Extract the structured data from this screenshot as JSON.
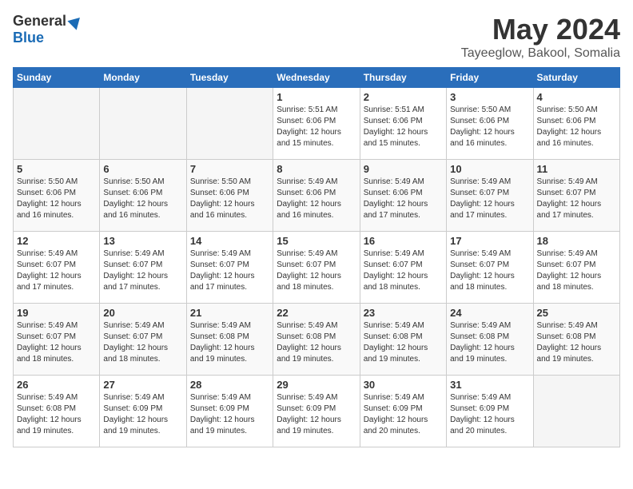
{
  "header": {
    "logo_general": "General",
    "logo_blue": "Blue",
    "title": "May 2024",
    "location": "Tayeeglow, Bakool, Somalia"
  },
  "days_of_week": [
    "Sunday",
    "Monday",
    "Tuesday",
    "Wednesday",
    "Thursday",
    "Friday",
    "Saturday"
  ],
  "weeks": [
    [
      {
        "day": "",
        "empty": true
      },
      {
        "day": "",
        "empty": true
      },
      {
        "day": "",
        "empty": true
      },
      {
        "day": "1",
        "sunrise": "5:51 AM",
        "sunset": "6:06 PM",
        "daylight": "12 hours and 15 minutes."
      },
      {
        "day": "2",
        "sunrise": "5:51 AM",
        "sunset": "6:06 PM",
        "daylight": "12 hours and 15 minutes."
      },
      {
        "day": "3",
        "sunrise": "5:50 AM",
        "sunset": "6:06 PM",
        "daylight": "12 hours and 16 minutes."
      },
      {
        "day": "4",
        "sunrise": "5:50 AM",
        "sunset": "6:06 PM",
        "daylight": "12 hours and 16 minutes."
      }
    ],
    [
      {
        "day": "5",
        "sunrise": "5:50 AM",
        "sunset": "6:06 PM",
        "daylight": "12 hours and 16 minutes."
      },
      {
        "day": "6",
        "sunrise": "5:50 AM",
        "sunset": "6:06 PM",
        "daylight": "12 hours and 16 minutes."
      },
      {
        "day": "7",
        "sunrise": "5:50 AM",
        "sunset": "6:06 PM",
        "daylight": "12 hours and 16 minutes."
      },
      {
        "day": "8",
        "sunrise": "5:49 AM",
        "sunset": "6:06 PM",
        "daylight": "12 hours and 16 minutes."
      },
      {
        "day": "9",
        "sunrise": "5:49 AM",
        "sunset": "6:06 PM",
        "daylight": "12 hours and 17 minutes."
      },
      {
        "day": "10",
        "sunrise": "5:49 AM",
        "sunset": "6:07 PM",
        "daylight": "12 hours and 17 minutes."
      },
      {
        "day": "11",
        "sunrise": "5:49 AM",
        "sunset": "6:07 PM",
        "daylight": "12 hours and 17 minutes."
      }
    ],
    [
      {
        "day": "12",
        "sunrise": "5:49 AM",
        "sunset": "6:07 PM",
        "daylight": "12 hours and 17 minutes."
      },
      {
        "day": "13",
        "sunrise": "5:49 AM",
        "sunset": "6:07 PM",
        "daylight": "12 hours and 17 minutes."
      },
      {
        "day": "14",
        "sunrise": "5:49 AM",
        "sunset": "6:07 PM",
        "daylight": "12 hours and 17 minutes."
      },
      {
        "day": "15",
        "sunrise": "5:49 AM",
        "sunset": "6:07 PM",
        "daylight": "12 hours and 18 minutes."
      },
      {
        "day": "16",
        "sunrise": "5:49 AM",
        "sunset": "6:07 PM",
        "daylight": "12 hours and 18 minutes."
      },
      {
        "day": "17",
        "sunrise": "5:49 AM",
        "sunset": "6:07 PM",
        "daylight": "12 hours and 18 minutes."
      },
      {
        "day": "18",
        "sunrise": "5:49 AM",
        "sunset": "6:07 PM",
        "daylight": "12 hours and 18 minutes."
      }
    ],
    [
      {
        "day": "19",
        "sunrise": "5:49 AM",
        "sunset": "6:07 PM",
        "daylight": "12 hours and 18 minutes."
      },
      {
        "day": "20",
        "sunrise": "5:49 AM",
        "sunset": "6:07 PM",
        "daylight": "12 hours and 18 minutes."
      },
      {
        "day": "21",
        "sunrise": "5:49 AM",
        "sunset": "6:08 PM",
        "daylight": "12 hours and 19 minutes."
      },
      {
        "day": "22",
        "sunrise": "5:49 AM",
        "sunset": "6:08 PM",
        "daylight": "12 hours and 19 minutes."
      },
      {
        "day": "23",
        "sunrise": "5:49 AM",
        "sunset": "6:08 PM",
        "daylight": "12 hours and 19 minutes."
      },
      {
        "day": "24",
        "sunrise": "5:49 AM",
        "sunset": "6:08 PM",
        "daylight": "12 hours and 19 minutes."
      },
      {
        "day": "25",
        "sunrise": "5:49 AM",
        "sunset": "6:08 PM",
        "daylight": "12 hours and 19 minutes."
      }
    ],
    [
      {
        "day": "26",
        "sunrise": "5:49 AM",
        "sunset": "6:08 PM",
        "daylight": "12 hours and 19 minutes."
      },
      {
        "day": "27",
        "sunrise": "5:49 AM",
        "sunset": "6:09 PM",
        "daylight": "12 hours and 19 minutes."
      },
      {
        "day": "28",
        "sunrise": "5:49 AM",
        "sunset": "6:09 PM",
        "daylight": "12 hours and 19 minutes."
      },
      {
        "day": "29",
        "sunrise": "5:49 AM",
        "sunset": "6:09 PM",
        "daylight": "12 hours and 19 minutes."
      },
      {
        "day": "30",
        "sunrise": "5:49 AM",
        "sunset": "6:09 PM",
        "daylight": "12 hours and 20 minutes."
      },
      {
        "day": "31",
        "sunrise": "5:49 AM",
        "sunset": "6:09 PM",
        "daylight": "12 hours and 20 minutes."
      },
      {
        "day": "",
        "empty": true
      }
    ]
  ],
  "labels": {
    "sunrise_prefix": "Sunrise: ",
    "sunset_prefix": "Sunset: ",
    "daylight_prefix": "Daylight: "
  }
}
